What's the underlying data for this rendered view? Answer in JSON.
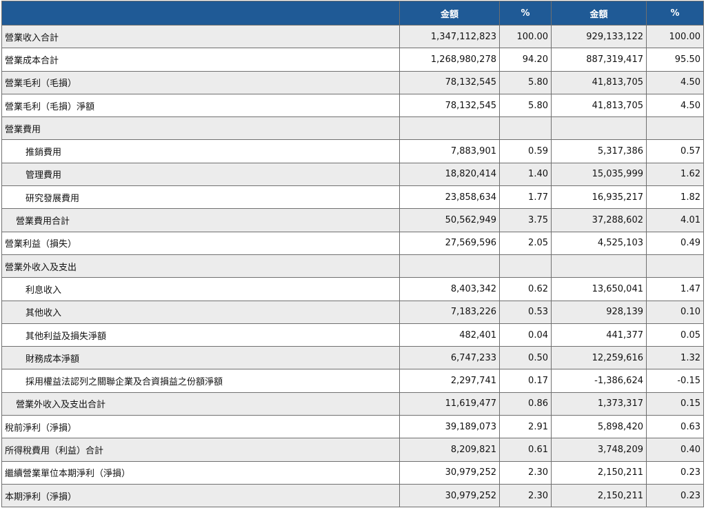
{
  "header": {
    "blank": "",
    "amount_current": "金額",
    "pct_current": "%",
    "amount_prior": "金額",
    "pct_prior": "%"
  },
  "rows": [
    {
      "label": "營業收入合計",
      "indent": 0,
      "amt1": "1,347,112,823",
      "pct1": "100.00",
      "amt2": "929,133,122",
      "pct2": "100.00"
    },
    {
      "label": "營業成本合計",
      "indent": 0,
      "amt1": "1,268,980,278",
      "pct1": "94.20",
      "amt2": "887,319,417",
      "pct2": "95.50"
    },
    {
      "label": "營業毛利（毛損）",
      "indent": 0,
      "amt1": "78,132,545",
      "pct1": "5.80",
      "amt2": "41,813,705",
      "pct2": "4.50"
    },
    {
      "label": "營業毛利（毛損）淨額",
      "indent": 0,
      "amt1": "78,132,545",
      "pct1": "5.80",
      "amt2": "41,813,705",
      "pct2": "4.50"
    },
    {
      "label": "營業費用",
      "indent": 0,
      "amt1": "",
      "pct1": "",
      "amt2": "",
      "pct2": ""
    },
    {
      "label": "推銷費用",
      "indent": 2,
      "amt1": "7,883,901",
      "pct1": "0.59",
      "amt2": "5,317,386",
      "pct2": "0.57"
    },
    {
      "label": "管理費用",
      "indent": 2,
      "amt1": "18,820,414",
      "pct1": "1.40",
      "amt2": "15,035,999",
      "pct2": "1.62"
    },
    {
      "label": "研究發展費用",
      "indent": 2,
      "amt1": "23,858,634",
      "pct1": "1.77",
      "amt2": "16,935,217",
      "pct2": "1.82"
    },
    {
      "label": "營業費用合計",
      "indent": 1,
      "amt1": "50,562,949",
      "pct1": "3.75",
      "amt2": "37,288,602",
      "pct2": "4.01"
    },
    {
      "label": "營業利益（損失）",
      "indent": 0,
      "amt1": "27,569,596",
      "pct1": "2.05",
      "amt2": "4,525,103",
      "pct2": "0.49"
    },
    {
      "label": "營業外收入及支出",
      "indent": 0,
      "amt1": "",
      "pct1": "",
      "amt2": "",
      "pct2": ""
    },
    {
      "label": "利息收入",
      "indent": 2,
      "amt1": "8,403,342",
      "pct1": "0.62",
      "amt2": "13,650,041",
      "pct2": "1.47"
    },
    {
      "label": "其他收入",
      "indent": 2,
      "amt1": "7,183,226",
      "pct1": "0.53",
      "amt2": "928,139",
      "pct2": "0.10"
    },
    {
      "label": "其他利益及損失淨額",
      "indent": 2,
      "amt1": "482,401",
      "pct1": "0.04",
      "amt2": "441,377",
      "pct2": "0.05"
    },
    {
      "label": "財務成本淨額",
      "indent": 2,
      "amt1": "6,747,233",
      "pct1": "0.50",
      "amt2": "12,259,616",
      "pct2": "1.32"
    },
    {
      "label": "採用權益法認列之關聯企業及合資損益之份額淨額",
      "indent": 2,
      "amt1": "2,297,741",
      "pct1": "0.17",
      "amt2": "-1,386,624",
      "pct2": "-0.15"
    },
    {
      "label": "營業外收入及支出合計",
      "indent": 1,
      "amt1": "11,619,477",
      "pct1": "0.86",
      "amt2": "1,373,317",
      "pct2": "0.15"
    },
    {
      "label": "稅前淨利（淨損）",
      "indent": 0,
      "amt1": "39,189,073",
      "pct1": "2.91",
      "amt2": "5,898,420",
      "pct2": "0.63"
    },
    {
      "label": "所得稅費用（利益）合計",
      "indent": 0,
      "amt1": "8,209,821",
      "pct1": "0.61",
      "amt2": "3,748,209",
      "pct2": "0.40"
    },
    {
      "label": "繼續營業單位本期淨利（淨損）",
      "indent": 0,
      "amt1": "30,979,252",
      "pct1": "2.30",
      "amt2": "2,150,211",
      "pct2": "0.23"
    },
    {
      "label": "本期淨利（淨損）",
      "indent": 0,
      "amt1": "30,979,252",
      "pct1": "2.30",
      "amt2": "2,150,211",
      "pct2": "0.23"
    }
  ],
  "colors": {
    "header_bg": "#1f5a96",
    "header_text": "#ffffff",
    "row_alt": "#ececec",
    "row_normal": "#ffffff",
    "border": "#6f6f6f"
  }
}
